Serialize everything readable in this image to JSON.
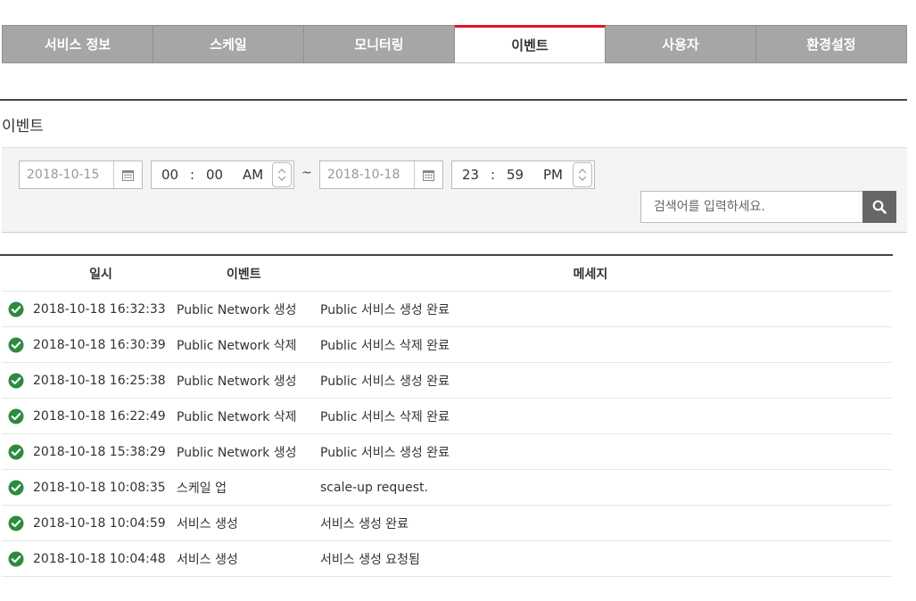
{
  "tabs": [
    {
      "label": "서비스 정보",
      "active": false
    },
    {
      "label": "스케일",
      "active": false
    },
    {
      "label": "모니터링",
      "active": false
    },
    {
      "label": "이벤트",
      "active": true
    },
    {
      "label": "사용자",
      "active": false
    },
    {
      "label": "환경설정",
      "active": false
    }
  ],
  "section_title": "이벤트",
  "filter": {
    "start_date": "2018-10-15",
    "start_hour": "00",
    "start_minute": "00",
    "start_ampm": "AM",
    "separator": "~",
    "end_date": "2018-10-18",
    "end_hour": "23",
    "end_minute": "59",
    "end_ampm": "PM",
    "time_sep": ":"
  },
  "search": {
    "placeholder": "검색어를 입력하세요."
  },
  "table": {
    "headers": {
      "date": "일시",
      "event": "이벤트",
      "message": "메세지"
    },
    "rows": [
      {
        "date": "2018-10-18 16:32:33",
        "event": "Public Network 생성",
        "message": "Public 서비스 생성 완료"
      },
      {
        "date": "2018-10-18 16:30:39",
        "event": "Public Network 삭제",
        "message": "Public 서비스 삭제 완료"
      },
      {
        "date": "2018-10-18 16:25:38",
        "event": "Public Network 생성",
        "message": "Public 서비스 생성 완료"
      },
      {
        "date": "2018-10-18 16:22:49",
        "event": "Public Network 삭제",
        "message": "Public 서비스 삭제 완료"
      },
      {
        "date": "2018-10-18 15:38:29",
        "event": "Public Network 생성",
        "message": "Public 서비스 생성 완료"
      },
      {
        "date": "2018-10-18 10:08:35",
        "event": "스케일 업",
        "message": "scale-up request."
      },
      {
        "date": "2018-10-18 10:04:59",
        "event": "서비스 생성",
        "message": "서비스 생성 완료"
      },
      {
        "date": "2018-10-18 10:04:48",
        "event": "서비스 생성",
        "message": "서비스 생성 요청됨"
      }
    ]
  },
  "colors": {
    "accent": "#e0162b",
    "tab_bg": "#a6a6a6",
    "success": "#2e8b3e"
  },
  "icons": {
    "calendar": "calendar-icon",
    "search": "search-icon",
    "status": "check-circle-icon"
  }
}
